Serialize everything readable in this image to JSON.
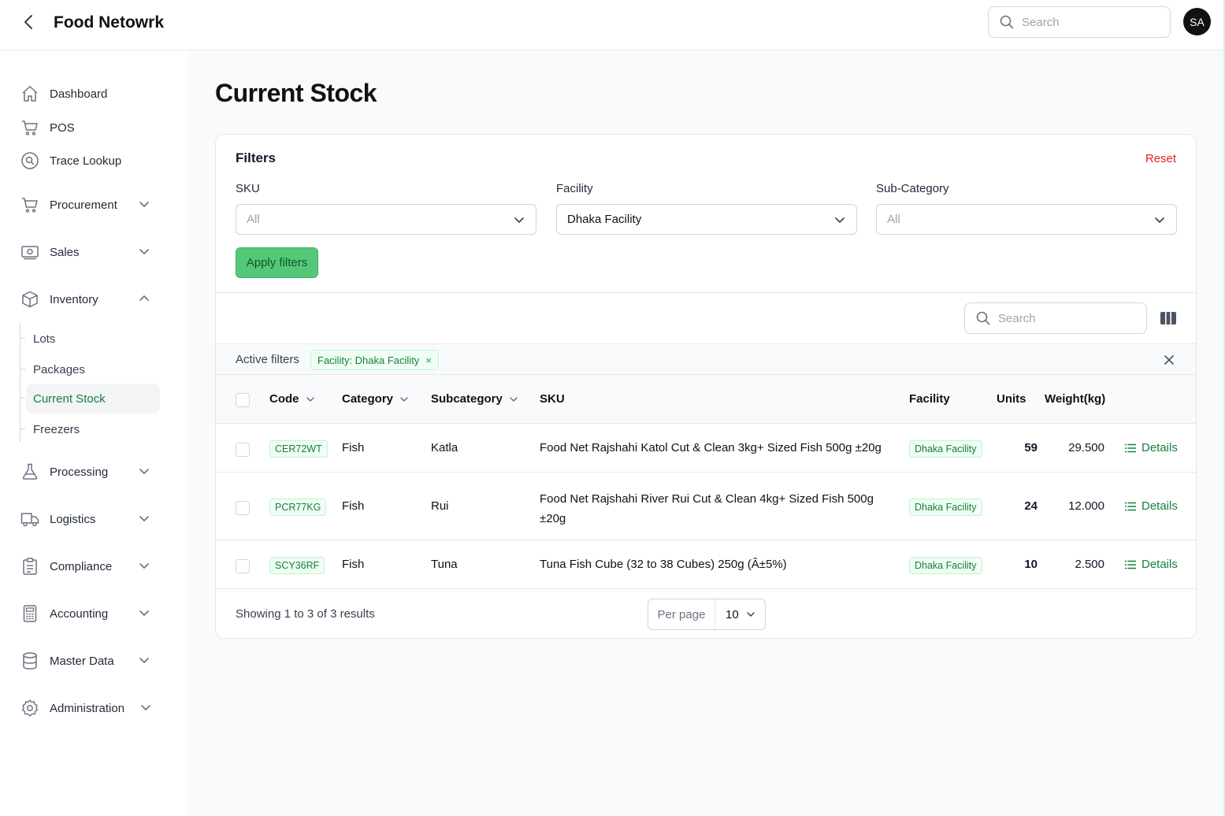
{
  "app": {
    "title": "Food Netowrk"
  },
  "header": {
    "search_placeholder": "Search",
    "avatar_initials": "SA"
  },
  "sidebar": {
    "items": [
      {
        "label": "Dashboard"
      },
      {
        "label": "POS"
      },
      {
        "label": "Trace Lookup"
      },
      {
        "label": "Procurement"
      },
      {
        "label": "Sales"
      },
      {
        "label": "Inventory"
      },
      {
        "label": "Processing"
      },
      {
        "label": "Logistics"
      },
      {
        "label": "Compliance"
      },
      {
        "label": "Accounting"
      },
      {
        "label": "Master Data"
      },
      {
        "label": "Administration"
      }
    ],
    "inventory_sub": [
      {
        "label": "Lots"
      },
      {
        "label": "Packages"
      },
      {
        "label": "Current Stock"
      },
      {
        "label": "Freezers"
      }
    ]
  },
  "page": {
    "title": "Current Stock"
  },
  "filters": {
    "title": "Filters",
    "reset_label": "Reset",
    "sku": {
      "label": "SKU",
      "value": "All"
    },
    "facility": {
      "label": "Facility",
      "value": "Dhaka Facility"
    },
    "subcategory": {
      "label": "Sub-Category",
      "value": "All"
    },
    "apply_label": "Apply filters"
  },
  "table_toolbar": {
    "search_placeholder": "Search"
  },
  "active_filters": {
    "label": "Active filters",
    "chips": [
      {
        "label": "Facility: Dhaka Facility",
        "remove": "×"
      }
    ]
  },
  "table": {
    "columns": {
      "code": "Code",
      "category": "Category",
      "subcategory": "Subcategory",
      "sku": "SKU",
      "facility": "Facility",
      "units": "Units",
      "weight": "Weight(kg)"
    },
    "rows": [
      {
        "code": "CER72WT",
        "category": "Fish",
        "subcategory": "Katla",
        "sku": "Food Net Rajshahi Katol Cut & Clean 3kg+ Sized Fish 500g ±20g",
        "facility": "Dhaka Facility",
        "units": "59",
        "weight": "29.500",
        "action": "Details"
      },
      {
        "code": "PCR77KG",
        "category": "Fish",
        "subcategory": "Rui",
        "sku": "Food Net Rajshahi River Rui Cut & Clean 4kg+ Sized Fish 500g ±20g",
        "facility": "Dhaka Facility",
        "units": "24",
        "weight": "12.000",
        "action": "Details"
      },
      {
        "code": "SCY36RF",
        "category": "Fish",
        "subcategory": "Tuna",
        "sku": "Tuna Fish Cube (32 to 38 Cubes) 250g (Â±5%)",
        "facility": "Dhaka Facility",
        "units": "10",
        "weight": "2.500",
        "action": "Details"
      }
    ]
  },
  "pagination": {
    "summary": "Showing 1 to 3 of 3 results",
    "per_page_label": "Per page",
    "per_page_value": "10"
  },
  "colors": {
    "accent": "#15803d",
    "apply_button": "#52c878",
    "reset": "#dc2626"
  }
}
